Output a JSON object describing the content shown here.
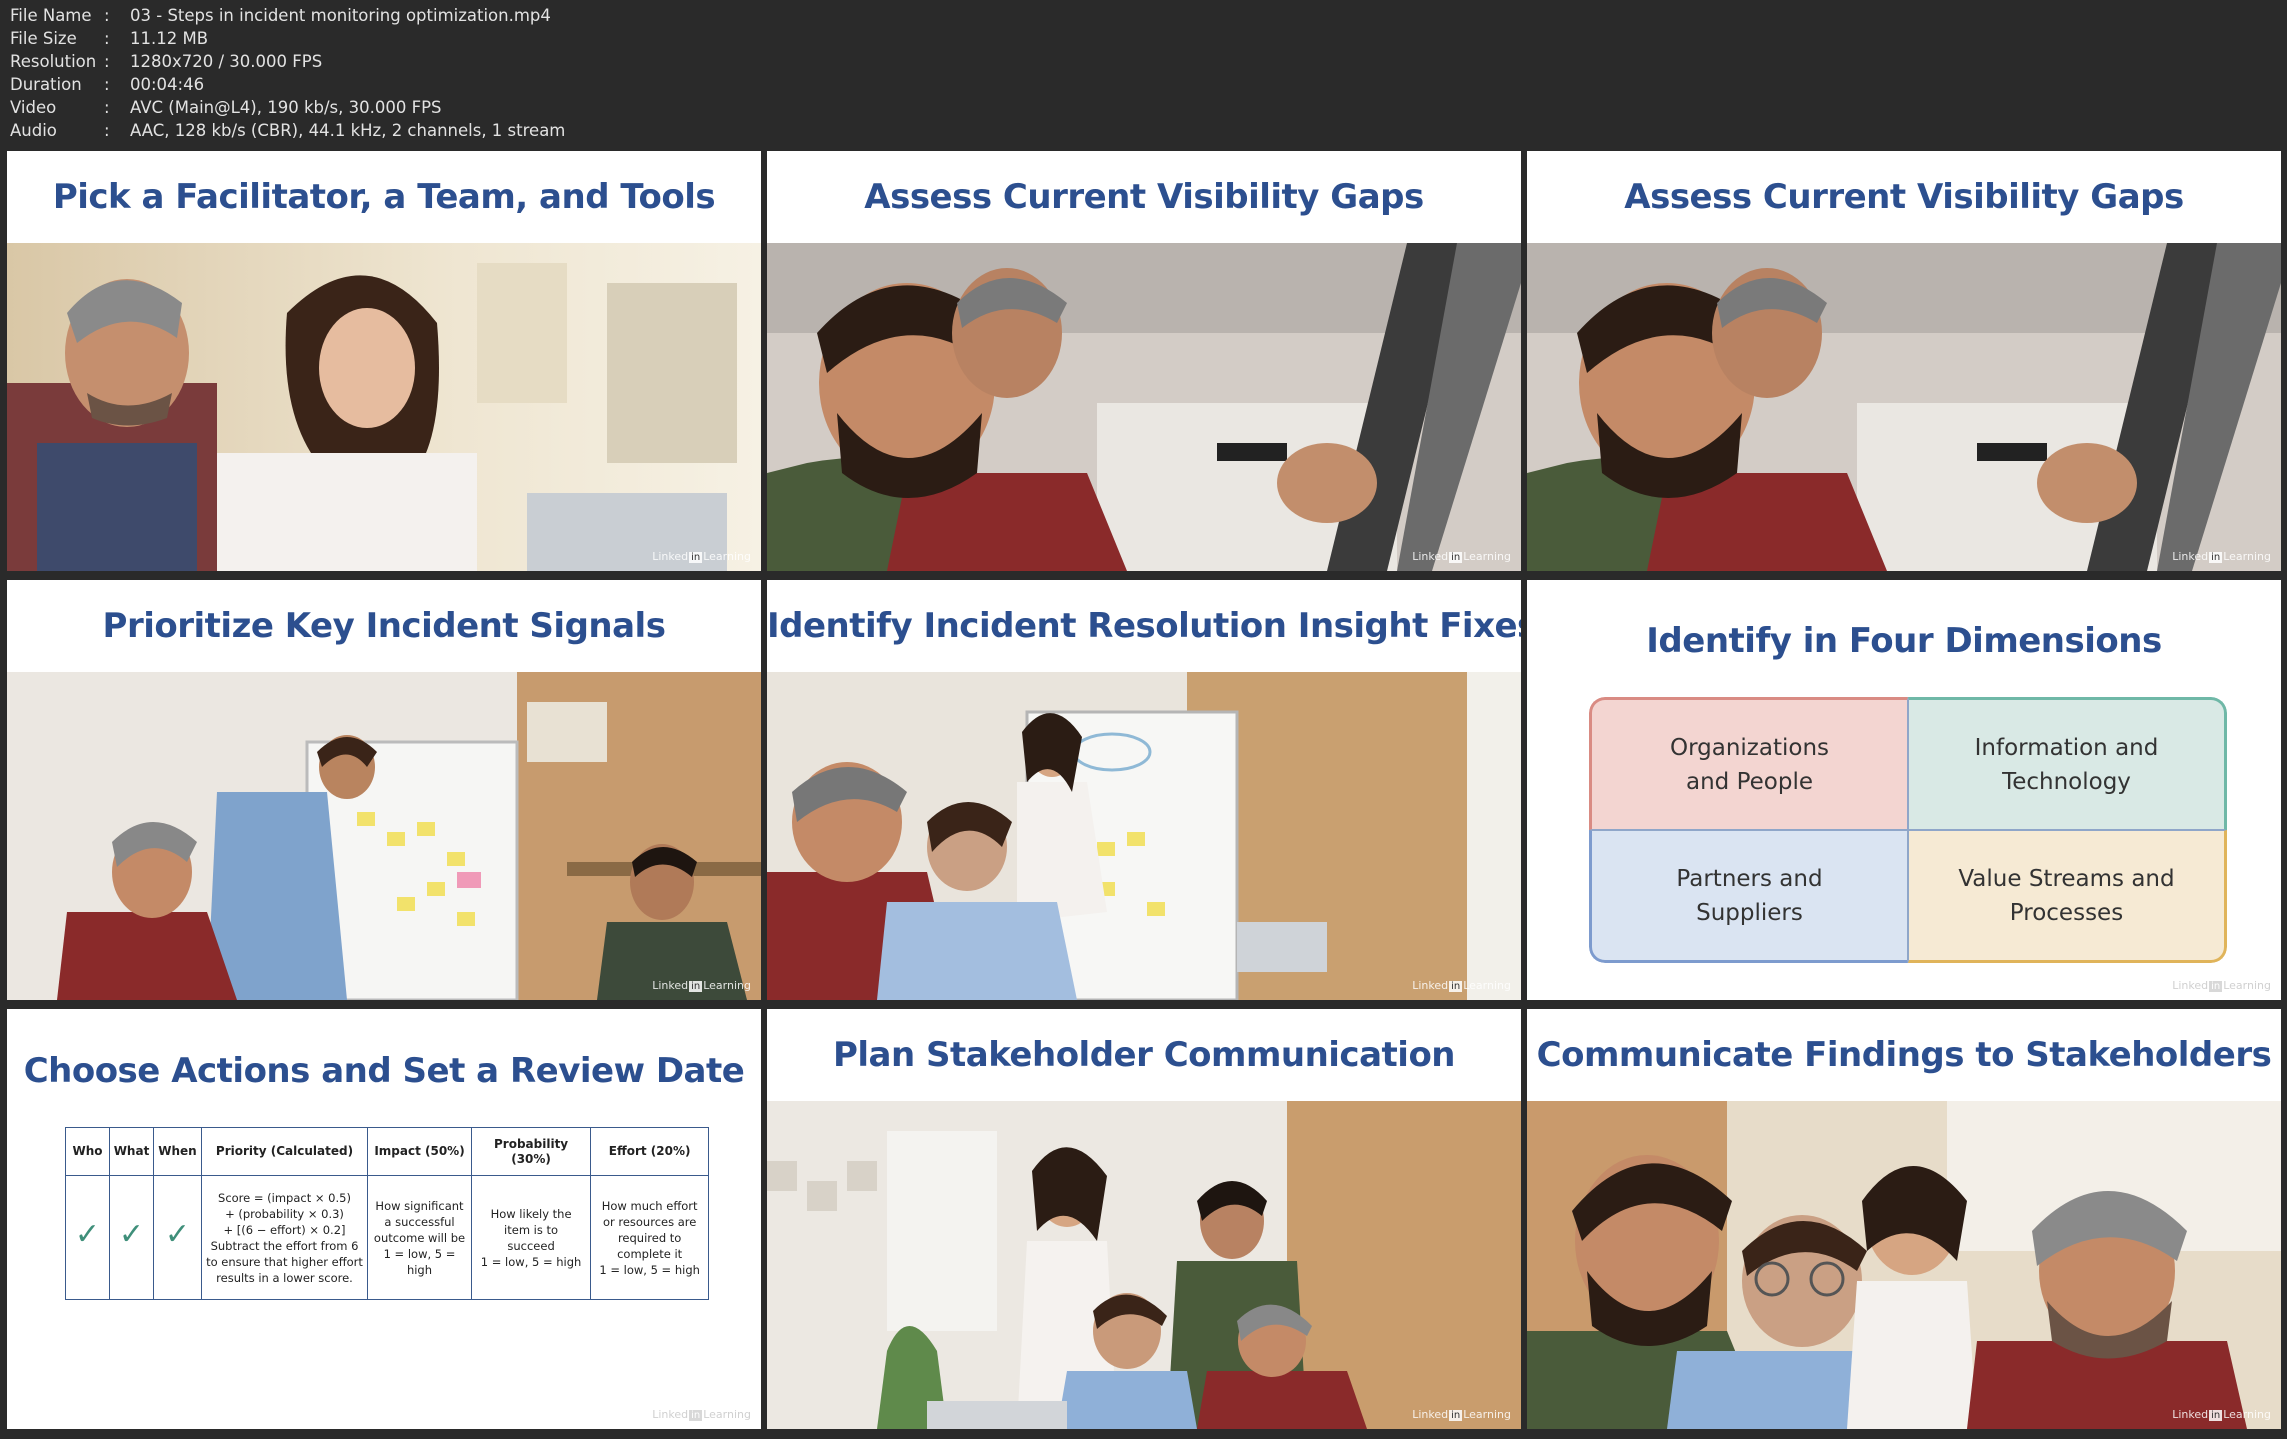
{
  "file_info": [
    {
      "key": "File Name",
      "value": "03 - Steps in incident monitoring optimization.mp4"
    },
    {
      "key": "File Size",
      "value": "11.12 MB"
    },
    {
      "key": "Resolution",
      "value": "1280x720 / 30.000 FPS"
    },
    {
      "key": "Duration",
      "value": "00:04:46"
    },
    {
      "key": "Video",
      "value": "AVC (Main@L4), 190 kb/s, 30.000 FPS"
    },
    {
      "key": "Audio",
      "value": "AAC, 128 kb/s (CBR), 44.1 kHz, 2 channels, 1 stream"
    }
  ],
  "watermark": {
    "left": "Linked",
    "box": "in",
    "right": "Learning"
  },
  "tiles": [
    {
      "title": "Pick a Facilitator, a Team, and Tools"
    },
    {
      "title": "Assess Current Visibility Gaps"
    },
    {
      "title": "Assess Current Visibility Gaps"
    },
    {
      "title": "Prioritize Key Incident Signals"
    },
    {
      "title": "Identify Incident Resolution Insight Fixes"
    },
    {
      "title": "Identify in Four Dimensions",
      "quadrants": [
        {
          "line1": "Organizations",
          "line2": "and People"
        },
        {
          "line1": "Information and",
          "line2": "Technology"
        },
        {
          "line1": "Partners and",
          "line2": "Suppliers"
        },
        {
          "line1": "Value Streams and",
          "line2": "Processes"
        }
      ]
    },
    {
      "title": "Choose Actions and Set a Review Date",
      "table": {
        "headers": [
          "Who",
          "What",
          "When",
          "Priority (Calculated)",
          "Impact (50%)",
          "Probability (30%)",
          "Effort (20%)"
        ],
        "priority_lines": [
          "Score = (impact × 0.5)",
          "+ (probability × 0.3)",
          "+ [(6 − effort) × 0.2]",
          "Subtract the effort  from 6",
          "to ensure that higher effort",
          "results in a lower score."
        ],
        "impact_lines": [
          "How significant",
          "a successful",
          "outcome will be",
          "1 = low, 5 = high"
        ],
        "probability_lines": [
          "How likely the",
          "item is to",
          "succeed",
          "1 = low, 5 = high"
        ],
        "effort_lines": [
          "How much effort",
          "or resources are",
          "required to",
          "complete it",
          "1 = low, 5 = high"
        ]
      }
    },
    {
      "title": "Plan Stakeholder Communication"
    },
    {
      "title": "Communicate Findings to Stakeholders"
    }
  ]
}
